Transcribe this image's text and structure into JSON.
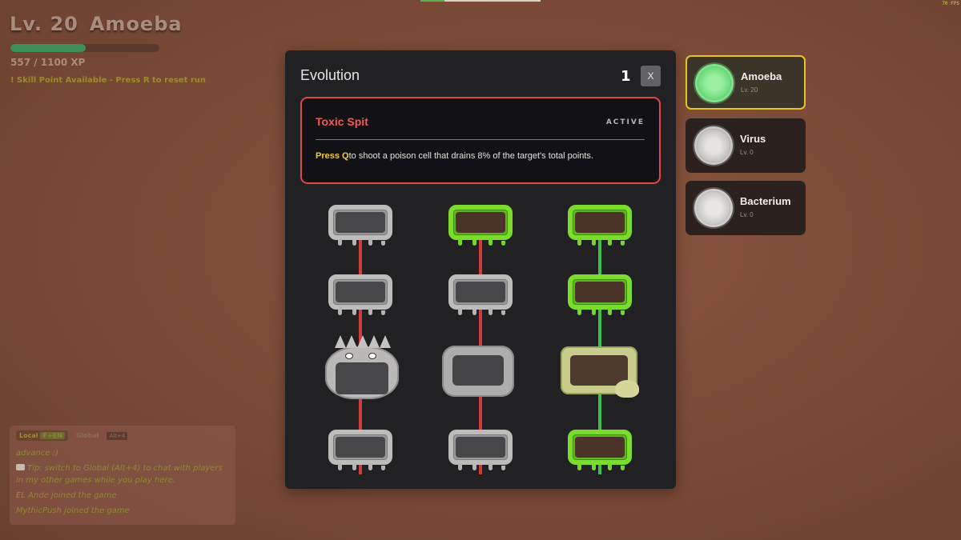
{
  "hud": {
    "level": "Lv. 20",
    "class_name": "Amoeba",
    "xp_text": "557 / 1100 XP",
    "xp_progress": 0.506,
    "skill_note": "! Skill Point Available - Press R to reset run"
  },
  "fps": "70 FPS",
  "evolution": {
    "title": "Evolution",
    "skill_points": "1",
    "close_label": "X",
    "ability": {
      "name": "Toxic Spit",
      "status": "ACTIVE",
      "key_hint": "Press Q",
      "description": "to shoot a poison cell that drains 8% of the target's total points."
    },
    "tree": {
      "columns": [
        {
          "line_color": "red",
          "nodes": [
            "locked",
            "locked",
            "locked-monster",
            "locked"
          ]
        },
        {
          "line_color": "red",
          "nodes": [
            "unlocked",
            "locked",
            "locked-cloud",
            "locked"
          ]
        },
        {
          "line_color": "green",
          "nodes": [
            "unlocked",
            "unlocked",
            "unlocked-slime",
            "unlocked"
          ]
        }
      ]
    }
  },
  "classes": [
    {
      "name": "Amoeba",
      "level": "Lv. 20",
      "icon": "amoeba-icon",
      "selected": true
    },
    {
      "name": "Virus",
      "level": "Lv. 0",
      "icon": "virus-icon",
      "selected": false
    },
    {
      "name": "Bacterium",
      "level": "Lv. 0",
      "icon": "bacterium-icon",
      "selected": false
    }
  ],
  "chat": {
    "tab_local": "Local",
    "tab_local_badge": "F+EN",
    "tab_global": "Global",
    "tab_global_key": "Alt+4",
    "lines": [
      "advance :)",
      "Tip: switch to Global (Alt+4) to chat with players in my other games while you play here.",
      "EL Ande joined the game",
      "MythicPush joined the game"
    ]
  },
  "colors": {
    "accent_selected": "#e8c320",
    "ability_border": "#e04848",
    "line_red": "#d33a3a",
    "line_green": "#3fbf49",
    "xp_fill": "#3e8f58"
  }
}
